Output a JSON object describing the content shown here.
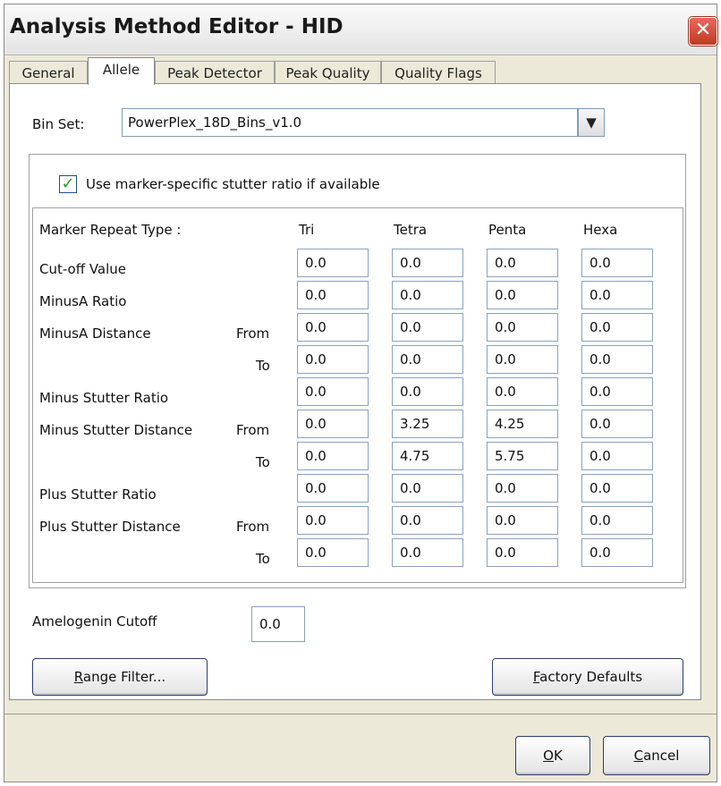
{
  "window": {
    "title": "Analysis Method Editor - HID",
    "close_label": "✕"
  },
  "tabs": [
    {
      "label": "General",
      "active": false
    },
    {
      "label": "Allele",
      "active": true
    },
    {
      "label": "Peak Detector",
      "active": false
    },
    {
      "label": "Peak Quality",
      "active": false
    },
    {
      "label": "Quality Flags",
      "active": false
    }
  ],
  "bin_set": {
    "label": "Bin Set:",
    "value": "PowerPlex_18D_Bins_v1.0"
  },
  "stutter_checkbox": {
    "checked": true,
    "label": "Use marker-specific stutter ratio if available"
  },
  "table": {
    "header_label": "Marker Repeat Type :",
    "columns": [
      "Tri",
      "Tetra",
      "Penta",
      "Hexa"
    ],
    "rows": [
      {
        "label": "Cut-off Value",
        "sub": "",
        "values": [
          "0.0",
          "0.0",
          "0.0",
          "0.0"
        ]
      },
      {
        "label": "MinusA Ratio",
        "sub": "",
        "values": [
          "0.0",
          "0.0",
          "0.0",
          "0.0"
        ]
      },
      {
        "label": "MinusA Distance",
        "sub": "From",
        "values": [
          "0.0",
          "0.0",
          "0.0",
          "0.0"
        ]
      },
      {
        "label": "",
        "sub": "To",
        "values": [
          "0.0",
          "0.0",
          "0.0",
          "0.0"
        ]
      },
      {
        "label": "Minus Stutter Ratio",
        "sub": "",
        "values": [
          "0.0",
          "0.0",
          "0.0",
          "0.0"
        ]
      },
      {
        "label": "Minus Stutter Distance",
        "sub": "From",
        "values": [
          "0.0",
          "3.25",
          "4.25",
          "0.0"
        ]
      },
      {
        "label": "",
        "sub": "To",
        "values": [
          "0.0",
          "4.75",
          "5.75",
          "0.0"
        ]
      },
      {
        "label": "Plus Stutter Ratio",
        "sub": "",
        "values": [
          "0.0",
          "0.0",
          "0.0",
          "0.0"
        ]
      },
      {
        "label": "Plus Stutter Distance",
        "sub": "From",
        "values": [
          "0.0",
          "0.0",
          "0.0",
          "0.0"
        ]
      },
      {
        "label": "",
        "sub": "To",
        "values": [
          "0.0",
          "0.0",
          "0.0",
          "0.0"
        ]
      }
    ]
  },
  "amelogenin": {
    "label": "Amelogenin Cutoff",
    "value": "0.0"
  },
  "buttons": {
    "range_filter": {
      "mnemonic": "R",
      "rest": "ange Filter..."
    },
    "factory_defaults": {
      "mnemonic": "F",
      "rest": "actory Defaults"
    },
    "ok": {
      "mnemonic": "O",
      "rest": "K"
    },
    "cancel": {
      "mnemonic": "C",
      "rest": "ancel"
    }
  }
}
